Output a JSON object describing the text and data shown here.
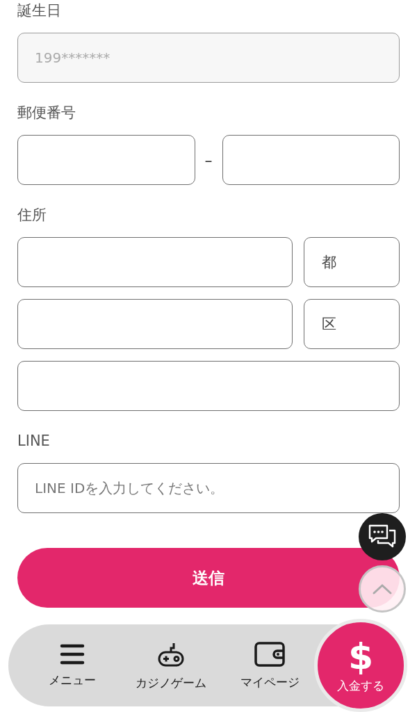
{
  "birthday": {
    "label": "誕生日",
    "value": "199*******",
    "disabled": true
  },
  "postal": {
    "label": "郵便番号",
    "separator": "–"
  },
  "address": {
    "label": "住所",
    "rows": [
      {
        "kind": "suffix",
        "suffix": "都"
      },
      {
        "kind": "suffix",
        "suffix": "区"
      },
      {
        "kind": "plain"
      }
    ]
  },
  "line": {
    "label": "LINE",
    "placeholder": "LINE IDを入力してください。"
  },
  "submit": "送信",
  "bottom_nav": {
    "items": [
      {
        "kind": "menu",
        "label": "メニュー"
      },
      {
        "kind": "game",
        "label": "カジノゲーム"
      },
      {
        "kind": "wallet",
        "label": "マイページ"
      }
    ],
    "deposit": {
      "symbol": "$",
      "label": "入金する"
    }
  }
}
